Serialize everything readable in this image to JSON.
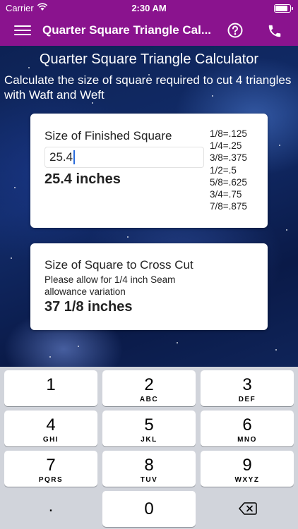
{
  "status_bar": {
    "carrier": "Carrier",
    "time": "2:30 AM"
  },
  "nav": {
    "title": "Quarter Square Triangle Cal...",
    "icons": [
      "menu-icon",
      "help-icon",
      "phone-icon"
    ]
  },
  "main": {
    "heading": "Quarter Square Triangle Calculator",
    "intro": "Calculate the size of square required to cut 4 triangles with Waft and Weft"
  },
  "finished_card": {
    "label": "Size of Finished Square",
    "input_value": "25.4",
    "result": "25.4 inches",
    "fractions": [
      "1/8=.125",
      "1/4=.25",
      "3/8=.375",
      "1/2=.5",
      "5/8=.625",
      "3/4=.75",
      "7/8=.875"
    ]
  },
  "cross_cut_card": {
    "label": "Size of Square to Cross Cut",
    "note": "Please allow for 1/4 inch Seam allowance variation",
    "result": "37 1/8 inches"
  },
  "keyboard": {
    "keys": [
      {
        "digit": "1",
        "letters": ""
      },
      {
        "digit": "2",
        "letters": "ABC"
      },
      {
        "digit": "3",
        "letters": "DEF"
      },
      {
        "digit": "4",
        "letters": "GHI"
      },
      {
        "digit": "5",
        "letters": "JKL"
      },
      {
        "digit": "6",
        "letters": "MNO"
      },
      {
        "digit": "7",
        "letters": "PQRS"
      },
      {
        "digit": "8",
        "letters": "TUV"
      },
      {
        "digit": "9",
        "letters": "WXYZ"
      }
    ],
    "dot": ".",
    "zero": "0",
    "backspace_icon": "backspace-icon"
  },
  "colors": {
    "nav_bar": "#8a138e",
    "keyboard_bg": "#d1d4db",
    "accent_caret": "#2a6cdb"
  }
}
